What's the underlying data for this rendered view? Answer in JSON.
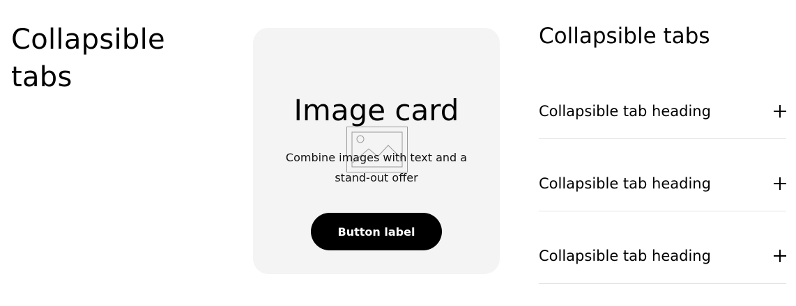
{
  "section": {
    "title": "Collapsible tabs"
  },
  "image_card": {
    "title": "Image card",
    "description": "Combine images with text and a stand-out offer",
    "button_label": "Button label",
    "placeholder_icon": "image-icon"
  },
  "collapsible_tabs": {
    "title": "Collapsible tabs",
    "items": [
      {
        "heading": "Collapsible tab heading",
        "icon": "plus-icon"
      },
      {
        "heading": "Collapsible tab heading",
        "icon": "plus-icon"
      },
      {
        "heading": "Collapsible tab heading",
        "icon": "plus-icon"
      }
    ]
  },
  "colors": {
    "card_background": "#f4f4f4",
    "button_background": "#000000",
    "button_text": "#ffffff",
    "divider": "#e3e3e3"
  }
}
